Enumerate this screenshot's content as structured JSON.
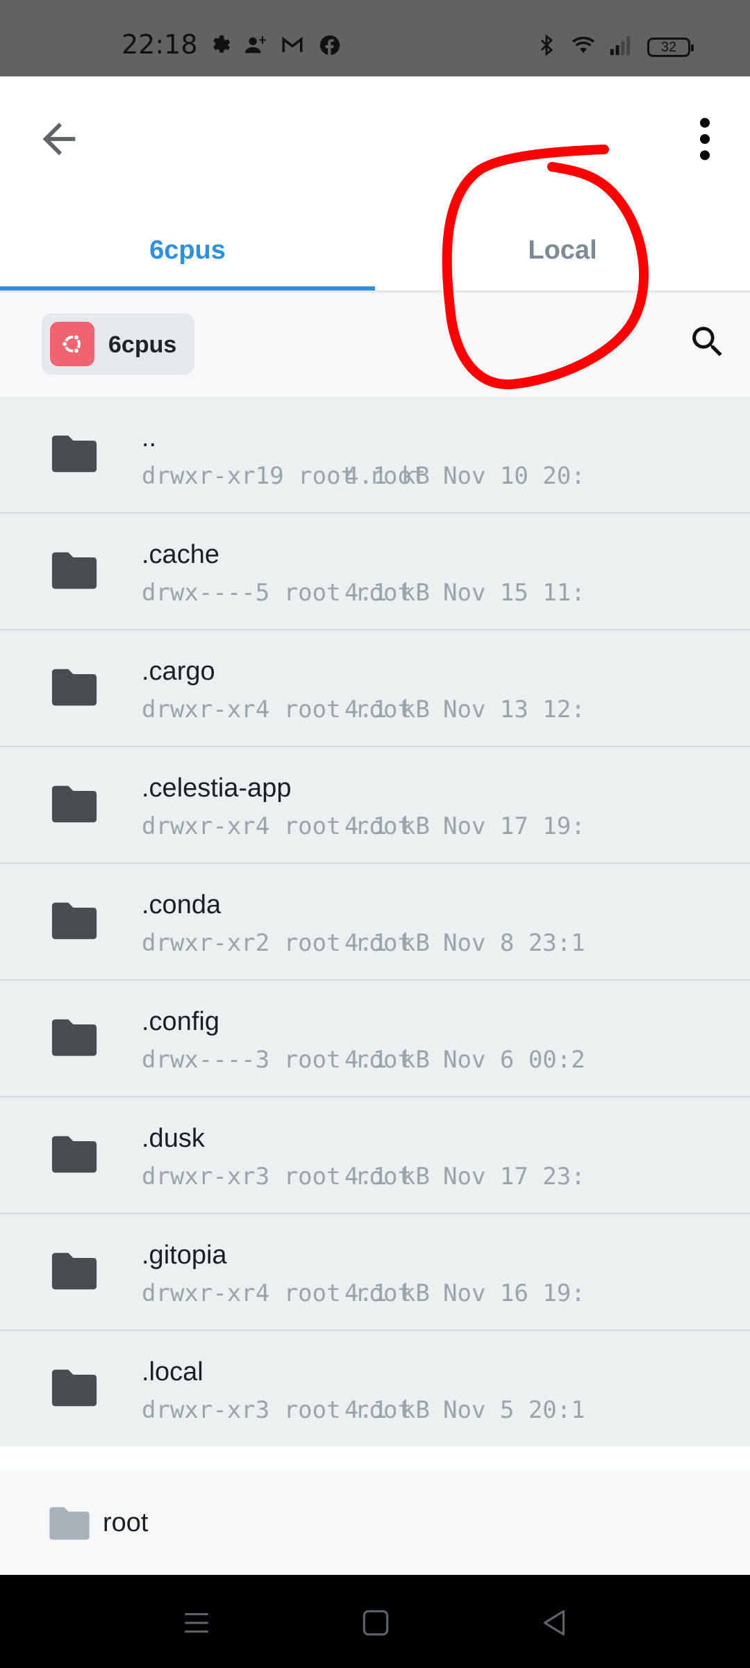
{
  "status_bar": {
    "time": "22:18",
    "battery": "32"
  },
  "tabs": [
    {
      "label": "6cpus",
      "active": true
    },
    {
      "label": "Local",
      "active": false
    }
  ],
  "host": {
    "name": "6cpus"
  },
  "files": [
    {
      "name": "..",
      "perms": "drwxr-xr19 root root",
      "size": "4.1 kB",
      "date": "Nov 10 20:"
    },
    {
      "name": ".cache",
      "perms": "drwx----5 root root",
      "size": "4.1 kB",
      "date": "Nov 15 11:"
    },
    {
      "name": ".cargo",
      "perms": "drwxr-xr4 root root",
      "size": "4.1 kB",
      "date": "Nov 13 12:"
    },
    {
      "name": ".celestia-app",
      "perms": "drwxr-xr4 root root",
      "size": "4.1 kB",
      "date": "Nov 17 19:"
    },
    {
      "name": ".conda",
      "perms": "drwxr-xr2 root root",
      "size": "4.1 kB",
      "date": "Nov 8 23:1"
    },
    {
      "name": ".config",
      "perms": "drwx----3 root root",
      "size": "4.1 kB",
      "date": "Nov 6 00:2"
    },
    {
      "name": ".dusk",
      "perms": "drwxr-xr3 root root",
      "size": "4.1 kB",
      "date": "Nov 17 23:"
    },
    {
      "name": ".gitopia",
      "perms": "drwxr-xr4 root root",
      "size": "4.1 kB",
      "date": "Nov 16 19:"
    },
    {
      "name": ".local",
      "perms": "drwxr-xr3 root root",
      "size": "4.1 kB",
      "date": "Nov 5 20:1"
    }
  ],
  "breadcrumb": {
    "label": "root"
  },
  "colors": {
    "accent": "#2f8fe0",
    "host_logo": "#f0646f",
    "annotation": "#ff0000"
  }
}
